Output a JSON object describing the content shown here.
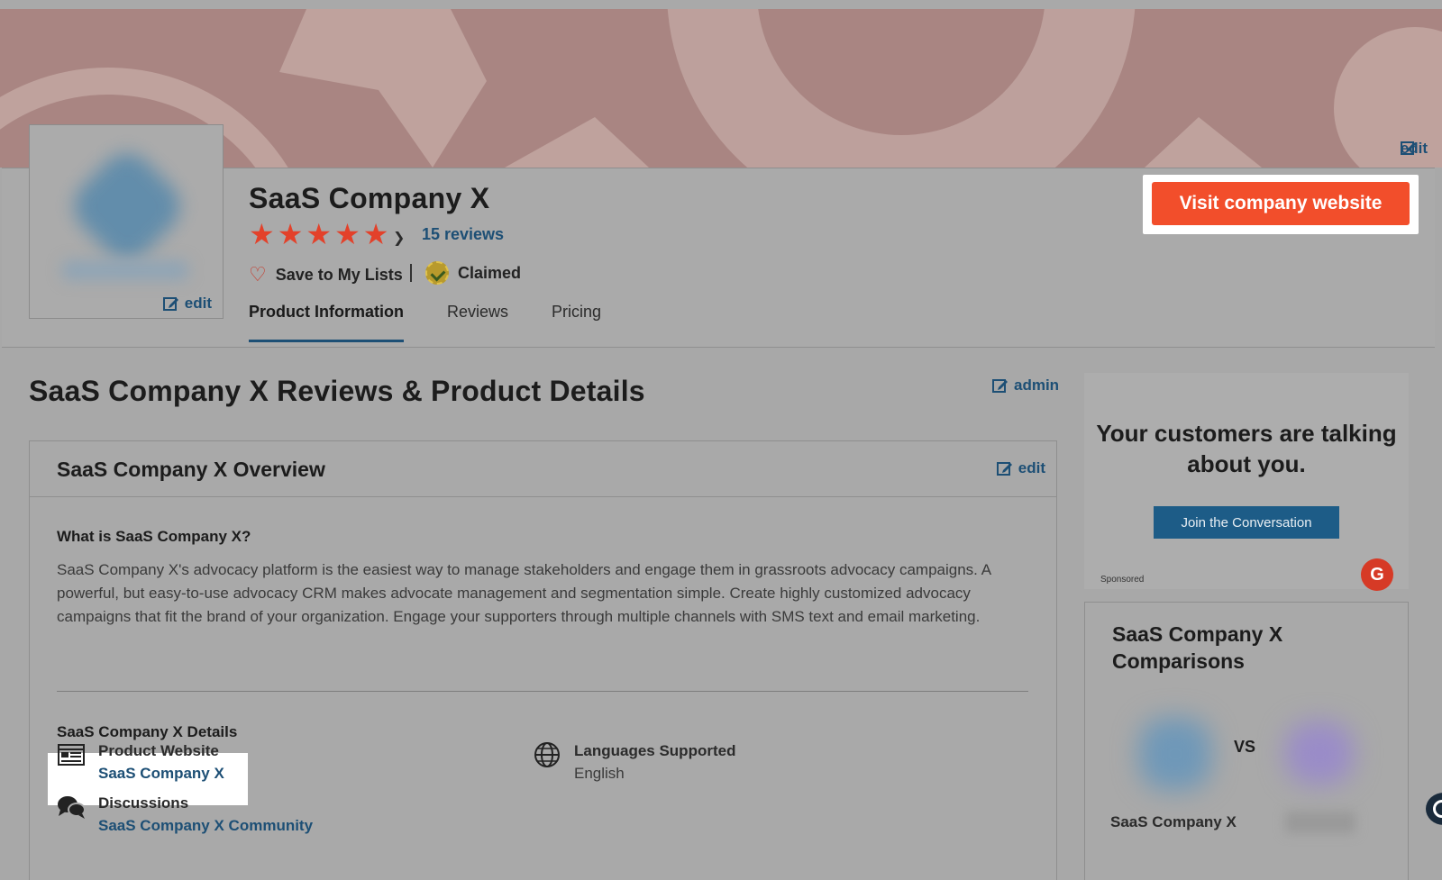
{
  "banner": {
    "edit_label": "edit"
  },
  "logo": {
    "edit_label": "edit"
  },
  "product": {
    "name": "SaaS Company X",
    "rating_stars": 5,
    "reviews_label": "15 reviews",
    "save_label": "Save to My Lists",
    "claimed_label": "Claimed"
  },
  "tabs": [
    {
      "label": "Product Information",
      "active": true
    },
    {
      "label": "Reviews",
      "active": false
    },
    {
      "label": "Pricing",
      "active": false
    }
  ],
  "cta": {
    "visit_label": "Visit company website",
    "color": "#f24e2b"
  },
  "page": {
    "heading": "SaaS Company X Reviews & Product Details",
    "admin_label": "admin"
  },
  "overview": {
    "title": "SaaS Company X Overview",
    "edit_label": "edit",
    "question": "What is SaaS Company X?",
    "description": "SaaS Company X's advocacy platform is the easiest way to manage stakeholders and engage them in grassroots advocacy campaigns. A powerful, but easy-to-use advocacy CRM makes advocate management and segmentation simple. Create highly customized advocacy campaigns that fit the brand of your organization. Engage your supporters through multiple channels with SMS text and email marketing.",
    "details_title": "SaaS Company X Details",
    "details": {
      "website_label": "Product Website",
      "website_value": "SaaS Company X",
      "discussions_label": "Discussions",
      "discussions_value": "SaaS Company X Community",
      "languages_label": "Languages Supported",
      "languages_value": "English"
    }
  },
  "ad": {
    "headline": "Your customers are talking about you.",
    "button_label": "Join the Conversation",
    "sponsored_label": "Sponsored",
    "logo_glyph": "G"
  },
  "comparisons": {
    "title": "SaaS Company X Comparisons",
    "vs_label": "VS",
    "left_name": "SaaS Company X"
  },
  "colors": {
    "accent_link": "#1d4f75",
    "star": "#e3412a",
    "cta": "#f24e2b"
  }
}
